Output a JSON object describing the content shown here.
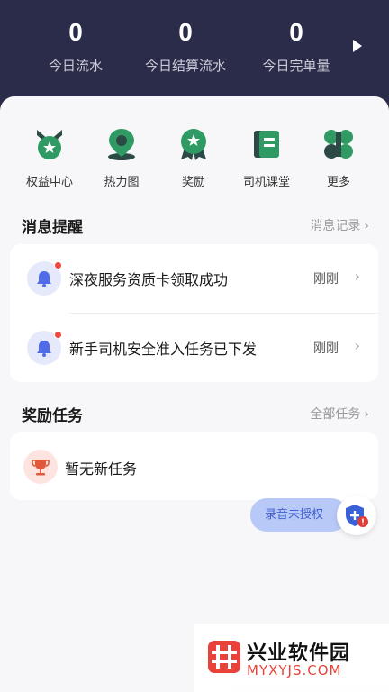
{
  "stats": [
    {
      "value": "0",
      "label": "今日流水"
    },
    {
      "value": "0",
      "label": "今日结算流水"
    },
    {
      "value": "0",
      "label": "今日完单量"
    }
  ],
  "quick_actions": [
    {
      "label": "权益中心",
      "icon": "rights-badge-icon"
    },
    {
      "label": "热力图",
      "icon": "map-pin-icon"
    },
    {
      "label": "奖励",
      "icon": "medal-icon"
    },
    {
      "label": "司机课堂",
      "icon": "classroom-book-icon"
    },
    {
      "label": "更多",
      "icon": "more-grid-icon"
    }
  ],
  "messages": {
    "title": "消息提醒",
    "link": "消息记录",
    "items": [
      {
        "text": "深夜服务资质卡领取成功",
        "time": "刚刚"
      },
      {
        "text": "新手司机安全准入任务已下发",
        "time": "刚刚"
      }
    ]
  },
  "tasks": {
    "title": "奖励任务",
    "link": "全部任务",
    "empty_text": "暂无新任务"
  },
  "floating": {
    "record_label": "录音未授权"
  },
  "watermark": {
    "title": "兴业软件园",
    "sub": "MYXYJS.COM"
  },
  "colors": {
    "header_bg": "#2b2c49",
    "accent_green": "#2f9a63",
    "accent_blue": "#3f5fd0",
    "alert_red": "#f1453d"
  }
}
